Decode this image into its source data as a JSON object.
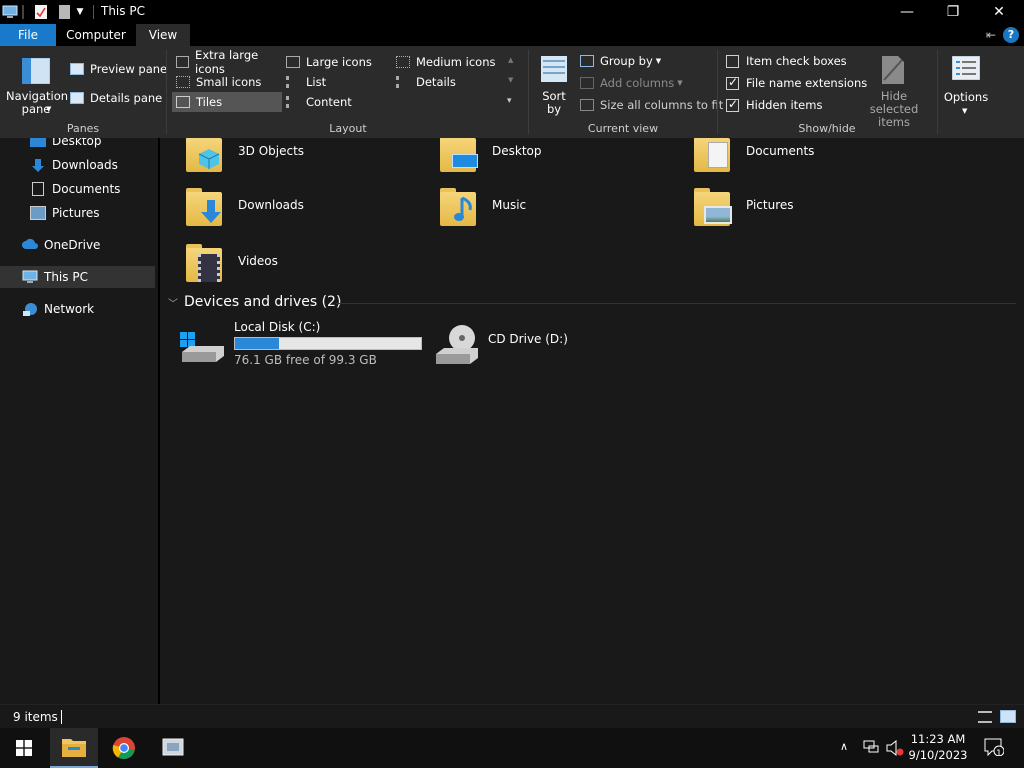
{
  "window": {
    "title": "This PC",
    "minimize": "—",
    "restore": "❐",
    "close": "✕"
  },
  "tabs": {
    "file": "File",
    "computer": "Computer",
    "view": "View"
  },
  "ribbon": {
    "panes": {
      "label": "Panes",
      "navigation_pane": "Navigation pane",
      "preview_pane": "Preview pane",
      "details_pane": "Details pane"
    },
    "layout": {
      "label": "Layout",
      "items": [
        "Extra large icons",
        "Large icons",
        "Medium icons",
        "Small icons",
        "List",
        "Details",
        "Tiles",
        "Content"
      ],
      "selected": "Tiles"
    },
    "current_view": {
      "label": "Current view",
      "sort_by": "Sort by",
      "group_by": "Group by",
      "add_columns": "Add columns",
      "size_all_columns": "Size all columns to fit"
    },
    "show_hide": {
      "label": "Show/hide",
      "item_check_boxes": "Item check boxes",
      "item_check_boxes_checked": false,
      "file_name_extensions": "File name extensions",
      "file_name_extensions_checked": true,
      "hidden_items": "Hidden items",
      "hidden_items_checked": true,
      "hide_selected_items": "Hide selected items"
    },
    "options": "Options"
  },
  "nav": {
    "items": [
      "Desktop",
      "Downloads",
      "Documents",
      "Pictures",
      "OneDrive",
      "This PC",
      "Network"
    ],
    "selected": "This PC"
  },
  "content": {
    "folders": [
      "3D Objects",
      "Desktop",
      "Documents",
      "Downloads",
      "Music",
      "Pictures",
      "Videos"
    ],
    "devices_header": "Devices and drives (2)",
    "drives": [
      {
        "name": "Local Disk (C:)",
        "free_text": "76.1 GB free of 99.3 GB",
        "used_fraction": 0.234
      },
      {
        "name": "CD Drive (D:)"
      }
    ]
  },
  "status": {
    "item_count": "9 items"
  },
  "taskbar": {
    "time": "11:23 AM",
    "date": "9/10/2023",
    "notifications_count": "1"
  },
  "colors": {
    "accent": "#1979ca",
    "folder": "#f0cd6b",
    "disk_bar": "#2b88d8"
  }
}
